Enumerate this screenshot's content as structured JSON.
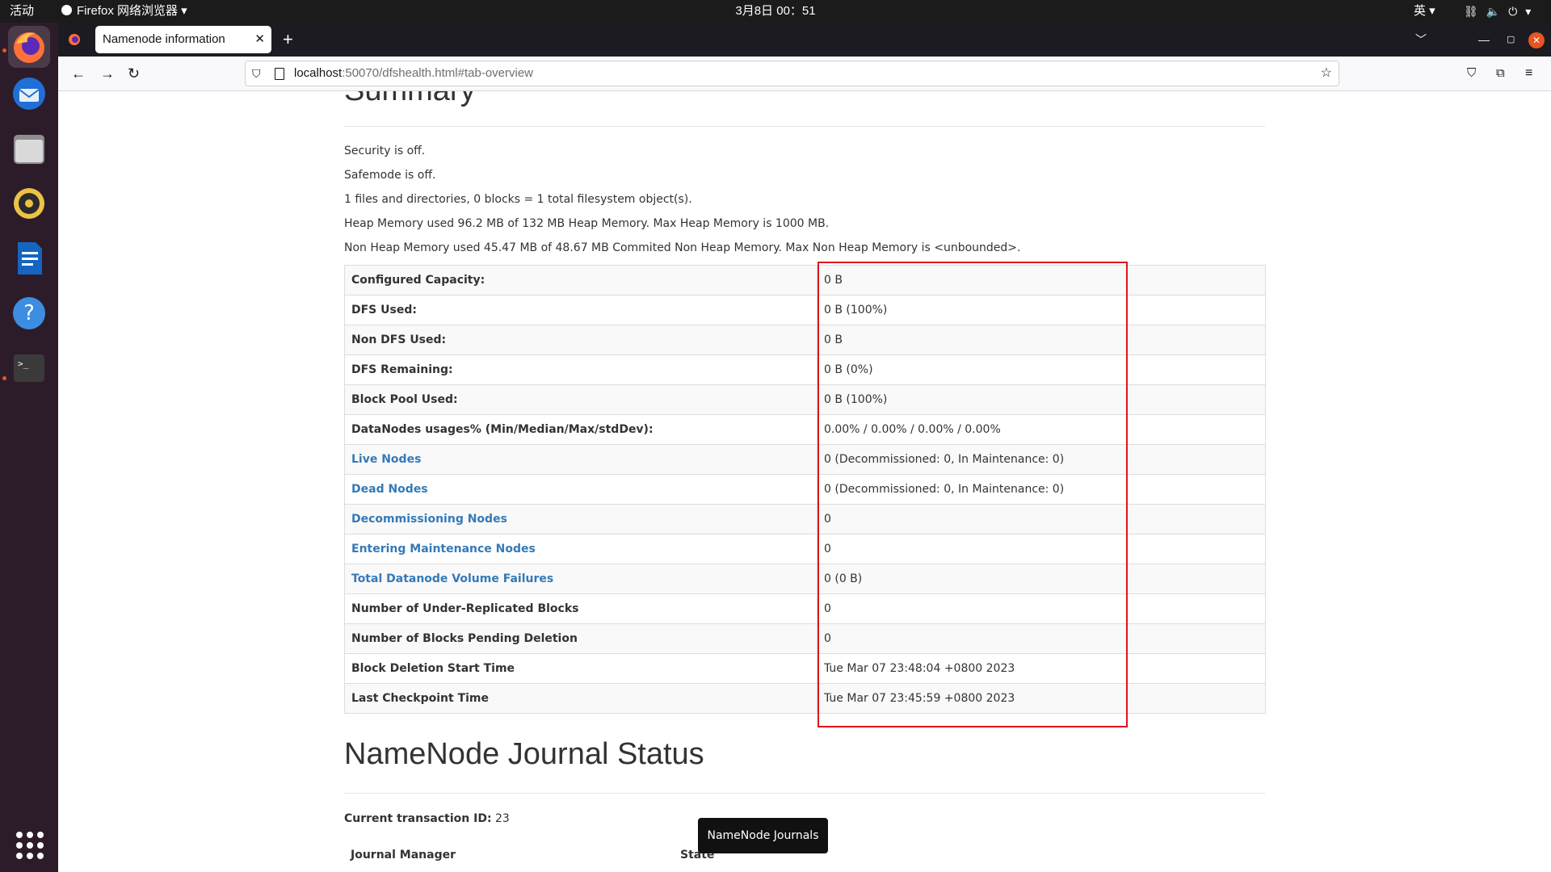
{
  "system": {
    "activities": "活动",
    "app_menu": "Firefox 网络浏览器",
    "clock": "3月8日  00：51",
    "ime": "英"
  },
  "browser": {
    "tab_title": "Namenode information",
    "url_host": "localhost",
    "url_rest": ":50070/dfshealth.html#tab-overview"
  },
  "page": {
    "summary_heading": "Summary",
    "lines": [
      "Security is off.",
      "Safemode is off.",
      "1 files and directories, 0 blocks = 1 total filesystem object(s).",
      "Heap Memory used 96.2 MB of 132 MB Heap Memory. Max Heap Memory is 1000 MB.",
      "Non Heap Memory used 45.47 MB of 48.67 MB Commited Non Heap Memory. Max Non Heap Memory is <unbounded>."
    ],
    "rows": [
      {
        "label": "Configured Capacity:",
        "value": "0 B",
        "link": false
      },
      {
        "label": "DFS Used:",
        "value": "0 B (100%)",
        "link": false
      },
      {
        "label": "Non DFS Used:",
        "value": "0 B",
        "link": false
      },
      {
        "label": "DFS Remaining:",
        "value": "0 B (0%)",
        "link": false
      },
      {
        "label": "Block Pool Used:",
        "value": "0 B (100%)",
        "link": false
      },
      {
        "label": "DataNodes usages% (Min/Median/Max/stdDev):",
        "value": "0.00% / 0.00% / 0.00% / 0.00%",
        "link": false
      },
      {
        "label": "Live Nodes",
        "value": "0 (Decommissioned: 0, In Maintenance: 0)",
        "link": true
      },
      {
        "label": "Dead Nodes",
        "value": "0 (Decommissioned: 0, In Maintenance: 0)",
        "link": true
      },
      {
        "label": "Decommissioning Nodes",
        "value": "0",
        "link": true
      },
      {
        "label": "Entering Maintenance Nodes",
        "value": "0",
        "link": true
      },
      {
        "label": "Total Datanode Volume Failures",
        "value": "0 (0 B)",
        "link": true
      },
      {
        "label": "Number of Under-Replicated Blocks",
        "value": "0",
        "link": false
      },
      {
        "label": "Number of Blocks Pending Deletion",
        "value": "0",
        "link": false
      },
      {
        "label": "Block Deletion Start Time",
        "value": "Tue Mar 07 23:48:04 +0800 2023",
        "link": false
      },
      {
        "label": "Last Checkpoint Time",
        "value": "Tue Mar 07 23:45:59 +0800 2023",
        "link": false
      }
    ],
    "journal_heading": "NameNode Journal Status",
    "txn_label": "Current transaction ID:",
    "txn_value": "23",
    "journal_col_manager": "Journal Manager",
    "journal_col_state": "State",
    "tooltip": "NameNode Journals"
  },
  "colors": {
    "link": "#337ab7",
    "highlight_border": "#e0141e",
    "dock_bg": "#2c1c2a",
    "ubuntu_orange": "#e95420"
  }
}
